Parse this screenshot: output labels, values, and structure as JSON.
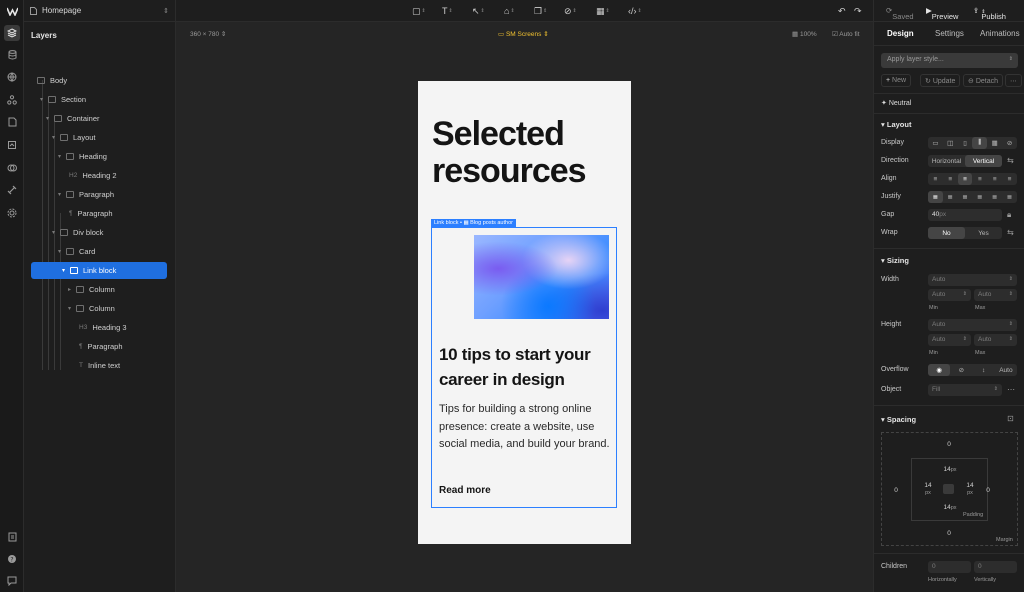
{
  "app": {
    "page_name": "Homepage"
  },
  "layers_panel": {
    "title": "Layers",
    "nodes": [
      {
        "label": "Body"
      },
      {
        "label": "Section"
      },
      {
        "label": "Container"
      },
      {
        "label": "Layout"
      },
      {
        "label": "Heading"
      },
      {
        "label": "Heading 2",
        "type_glyph": "H2"
      },
      {
        "label": "Paragraph"
      },
      {
        "label": "Paragraph",
        "type_glyph": "¶"
      },
      {
        "label": "Div block"
      },
      {
        "label": "Card"
      },
      {
        "label": "Link block"
      },
      {
        "label": "Column"
      },
      {
        "label": "Column"
      },
      {
        "label": "Heading 3",
        "type_glyph": "H3"
      },
      {
        "label": "Paragraph",
        "type_glyph": "¶"
      },
      {
        "label": "Inline text",
        "type_glyph": "T"
      }
    ],
    "selected_label": "Link block"
  },
  "canvas": {
    "size_label": "360 × 780",
    "breakpoint_label": "SM Screens",
    "zoom_label": "100%",
    "autofit_label": "Auto fit",
    "page": {
      "heading": "Selected resources",
      "link_tag": "Link block  •  ▦ Blog posts author",
      "card_heading": "10 tips to start your career in design",
      "card_paragraph": "Tips for building a strong online presence: create a website, use social media, and build your brand.",
      "card_link": "Read more"
    }
  },
  "right_panel": {
    "saved_label": "Saved",
    "preview_label": "Preview",
    "publish_label": "Publish",
    "tabs": [
      "Design",
      "Settings",
      "Animations"
    ],
    "active_tab": "Design",
    "style_placeholder": "Apply layer style...",
    "actions": {
      "new": "New",
      "update": "Update",
      "detach": "Detach"
    },
    "token": "Neutral",
    "layout": {
      "title": "Layout",
      "display_label": "Display",
      "direction_label": "Direction",
      "direction_options": [
        "Horizontal",
        "Vertical"
      ],
      "direction_selected": "Vertical",
      "align_label": "Align",
      "justify_label": "Justify",
      "gap_label": "Gap",
      "gap_value": "40",
      "gap_unit": "px",
      "wrap_label": "Wrap",
      "wrap_options": [
        "No",
        "Yes"
      ],
      "wrap_selected": "No"
    },
    "sizing": {
      "title": "Sizing",
      "width_label": "Width",
      "height_label": "Height",
      "auto": "Auto",
      "min_label": "Min",
      "max_label": "Max",
      "overflow_label": "Overflow",
      "overflow_auto": "Auto",
      "object_label": "Object",
      "object_value": "Fill"
    },
    "spacing": {
      "title": "Spacing",
      "margin_label": "Margin",
      "padding_label": "Padding",
      "margin": {
        "top": "0",
        "right": "0",
        "bottom": "0",
        "left": "0"
      },
      "padding": {
        "top": "14",
        "right": "14",
        "bottom": "14",
        "left": "14"
      },
      "unit": "px"
    },
    "children": {
      "label": "Children",
      "horizontally_value": "0",
      "vertically_value": "0",
      "horizontally_label": "Horizontally",
      "vertically_label": "Vertically"
    }
  },
  "colors": {
    "accent": "#1f6fe0",
    "selection": "#2c7fff",
    "breakpoint": "#f2c230"
  }
}
